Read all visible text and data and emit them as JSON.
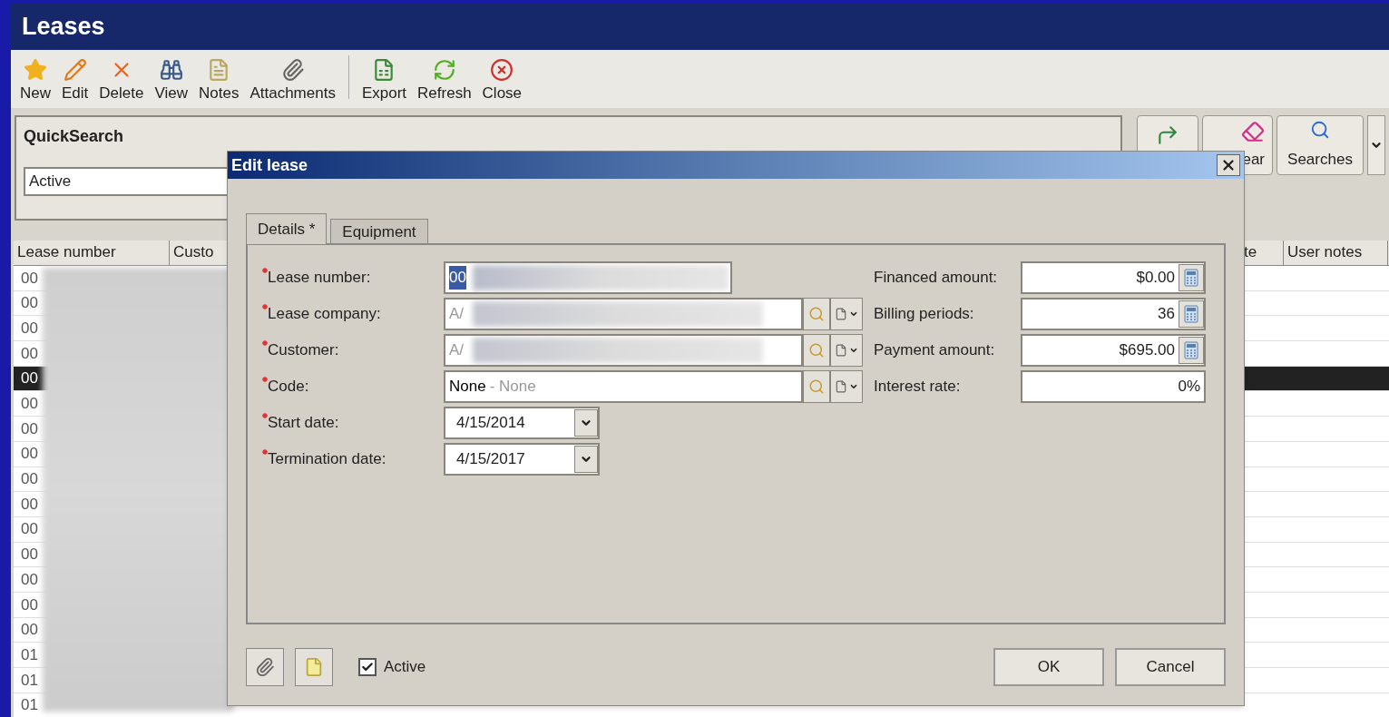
{
  "window": {
    "title": "Leases"
  },
  "toolbar": [
    {
      "kind": "new",
      "label": "New"
    },
    {
      "kind": "edit",
      "label": "Edit"
    },
    {
      "kind": "delete",
      "label": "Delete"
    },
    {
      "kind": "view",
      "label": "View"
    },
    {
      "kind": "notes",
      "label": "Notes"
    },
    {
      "kind": "attachments",
      "label": "Attachments"
    },
    {
      "kind": "separator"
    },
    {
      "kind": "export",
      "label": "Export"
    },
    {
      "kind": "refresh",
      "label": "Refresh"
    },
    {
      "kind": "close",
      "label": "Close"
    }
  ],
  "quick_search": {
    "title": "QuickSearch",
    "value": "Active"
  },
  "search_buttons": [
    {
      "kind": "go"
    },
    {
      "kind": "clear",
      "label": "ear"
    },
    {
      "kind": "searches",
      "label": "Searches"
    },
    {
      "kind": "menu"
    }
  ],
  "grid": {
    "columns": [
      "Lease number",
      "Custo",
      "te",
      "User notes"
    ],
    "rows": [
      {
        "lease_number": "00",
        "selected": false
      },
      {
        "lease_number": "00",
        "selected": false
      },
      {
        "lease_number": "00",
        "selected": false
      },
      {
        "lease_number": "00",
        "selected": false
      },
      {
        "lease_number": "00",
        "selected": true
      },
      {
        "lease_number": "00",
        "selected": false
      },
      {
        "lease_number": "00",
        "selected": false
      },
      {
        "lease_number": "00",
        "selected": false
      },
      {
        "lease_number": "00",
        "selected": false
      },
      {
        "lease_number": "00",
        "selected": false
      },
      {
        "lease_number": "00",
        "selected": false
      },
      {
        "lease_number": "00",
        "selected": false
      },
      {
        "lease_number": "00",
        "selected": false
      },
      {
        "lease_number": "00",
        "selected": false
      },
      {
        "lease_number": "00",
        "selected": false
      },
      {
        "lease_number": "01",
        "selected": false
      },
      {
        "lease_number": "01",
        "selected": false
      },
      {
        "lease_number": "01",
        "selected": false
      }
    ]
  },
  "dialog": {
    "title": "Edit lease",
    "tabs": [
      {
        "label": "Details *",
        "selected": true
      },
      {
        "label": "Equipment",
        "selected": false
      }
    ],
    "left_fields": [
      {
        "label": "Lease number:",
        "required": true,
        "kind": "text",
        "value": "00"
      },
      {
        "label": "Lease company:",
        "required": true,
        "kind": "lookup",
        "value": "A/"
      },
      {
        "label": "Customer:",
        "required": true,
        "kind": "lookup",
        "value": "A/"
      },
      {
        "label": "Code:",
        "required": true,
        "kind": "lookup",
        "value": "None",
        "description": "- None"
      },
      {
        "label": "Start date:",
        "required": true,
        "kind": "date",
        "value": "4/15/2014"
      },
      {
        "label": "Termination date:",
        "required": true,
        "kind": "date",
        "value": "4/15/2017"
      }
    ],
    "right_fields": [
      {
        "label": "Financed amount:",
        "value": "$0.00",
        "calculator": true
      },
      {
        "label": "Billing periods:",
        "value": "36",
        "calculator": true
      },
      {
        "label": "Payment amount:",
        "value": "$695.00",
        "calculator": true
      },
      {
        "label": "Interest rate:",
        "value": "0%",
        "calculator": false
      }
    ],
    "active": {
      "label": "Active",
      "checked": true
    },
    "buttons": [
      "OK",
      "Cancel"
    ]
  }
}
